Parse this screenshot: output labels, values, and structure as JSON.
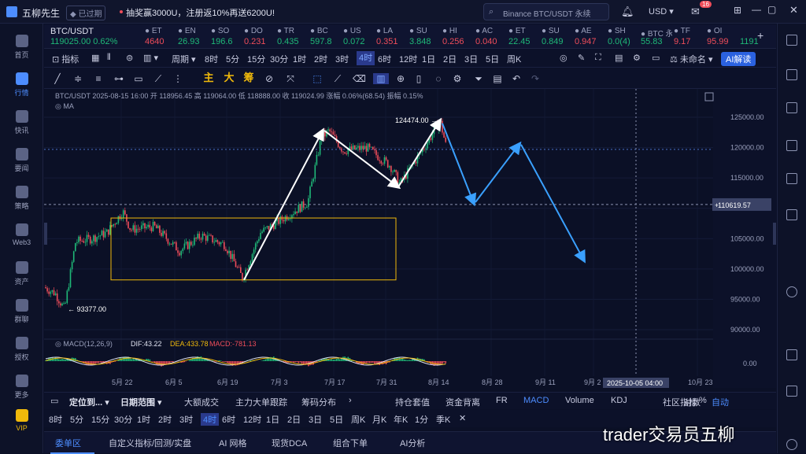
{
  "app": {
    "name": "五柳先生",
    "status": "已过期",
    "promo": "抽奖赢3000U，注册返10%再送6200U!",
    "search_placeholder": "Binance BTC/USDT 永续",
    "currency": "USD",
    "mail_badge": "16"
  },
  "tickers": [
    {
      "name": "BTC/USDT",
      "price": "119025.00",
      "change": "0.62%",
      "dir": "up"
    },
    {
      "name": "ET",
      "price": "4640",
      "dir": "dn"
    },
    {
      "name": "EN",
      "price": "26.93",
      "dir": "up"
    },
    {
      "name": "SO",
      "price": "196.6",
      "dir": "up"
    },
    {
      "name": "DO",
      "price": "0.231",
      "dir": "dn"
    },
    {
      "name": "TR",
      "price": "0.435",
      "dir": "up"
    },
    {
      "name": "BC",
      "price": "597.8",
      "dir": "up"
    },
    {
      "name": "US",
      "price": "0.072",
      "dir": "up"
    },
    {
      "name": "LA",
      "price": "0.351",
      "dir": "dn"
    },
    {
      "name": "SU",
      "price": "3.848",
      "dir": "up"
    },
    {
      "name": "HI",
      "price": "0.256",
      "dir": "dn"
    },
    {
      "name": "AC",
      "price": "0.040",
      "dir": "dn"
    },
    {
      "name": "ET",
      "price": "22.45",
      "dir": "up"
    },
    {
      "name": "SU",
      "price": "0.849",
      "dir": "up"
    },
    {
      "name": "AE",
      "price": "0.947",
      "dir": "dn"
    },
    {
      "name": "SH",
      "price": "0.0(4)",
      "dir": "up"
    },
    {
      "name": "BTC 永",
      "price": "55.83",
      "dir": "up"
    },
    {
      "name": "TF",
      "price": "9.17",
      "dir": "dn"
    },
    {
      "name": "OI",
      "price": "95.99",
      "dir": "dn"
    },
    {
      "name": "",
      "price": "1191",
      "dir": "up"
    }
  ],
  "toolbar1": {
    "indicator": "指标",
    "period": "周期",
    "intervals": [
      "8时",
      "5分",
      "15分",
      "30分",
      "1时",
      "2时",
      "3时",
      "4时",
      "6时",
      "12时",
      "1日",
      "2日",
      "3日",
      "5日",
      "周K"
    ],
    "selected": "4时",
    "layout": "未命名",
    "ai": "AI解读"
  },
  "toolbar2": {
    "zhu": "主",
    "da": "大",
    "chou": "筹"
  },
  "chart": {
    "symbol_line": "BTC/USDT  2025-08-15 16:00  开 118956.45 高 119064.00 低 118888.00 收 119024.99 涨幅 0.06%(68.54) 振幅 0.15%",
    "ma_label": "MA",
    "high_label": "124474.00",
    "low_label": "93377.00",
    "current_price": "110619.57",
    "y_ticks": [
      "125000.00",
      "120000.00",
      "115000.00",
      "110000.00",
      "105000.00",
      "100000.00",
      "95000.00",
      "90000.00",
      "0.00"
    ],
    "x_ticks": [
      "5月 22",
      "6月 5",
      "6月 19",
      "7月 3",
      "7月 17",
      "7月 31",
      "8月 14",
      "8月 28",
      "9月 11",
      "9月 2",
      "10月 23"
    ],
    "crosshair_time": "2025-10-05 04:00",
    "macd_label": "MACD(12,26,9)",
    "dif": "DIF:43.22",
    "dea": "DEA:433.78",
    "macd": "MACD:-781.13",
    "colors": {
      "up": "#1fb978",
      "down": "#ef4d5a",
      "arrow_white": "#ffffff",
      "arrow_blue": "#3aa0ff",
      "box": "#f0b90b"
    }
  },
  "bottom1": {
    "items": [
      "定位到...",
      "日期范围",
      "大额成交",
      "主力大单跟踪",
      "筹码分布",
      "持仓套值",
      "资金背离",
      "FR",
      "MACD",
      "Volume",
      "KDJ",
      "社区指标",
      "对数",
      "%",
      "自动"
    ],
    "active": "MACD"
  },
  "bottom2": {
    "items": [
      "8时",
      "5分",
      "15分",
      "30分",
      "1时",
      "2时",
      "3时",
      "4时",
      "6时",
      "12时",
      "1日",
      "2日",
      "3日",
      "5日",
      "周K",
      "月K",
      "年K",
      "1分",
      "季K"
    ],
    "selected": "4时"
  },
  "tabs": {
    "items": [
      "委单区",
      "自定义指标/回测/实盘",
      "AI 网格",
      "现货DCA",
      "组合下单",
      "AI分析"
    ],
    "active": "委单区"
  },
  "leftnav": [
    "首页",
    "行情",
    "快讯",
    "要闻",
    "策略",
    "Web3",
    "资产",
    "群聊",
    "授权",
    "更多",
    "VIP"
  ],
  "watermark": "trader交易员五柳"
}
